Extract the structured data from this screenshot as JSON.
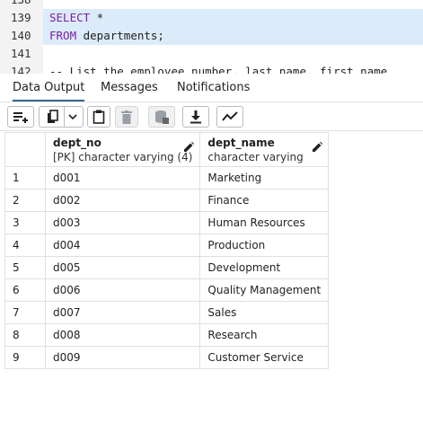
{
  "editor": {
    "lines": [
      {
        "num": "138",
        "code": ""
      },
      {
        "num": "139",
        "kw": "SELECT",
        "rest": " *"
      },
      {
        "num": "140",
        "kw": "FROM",
        "rest": " departments;"
      },
      {
        "num": "141",
        "code": ""
      },
      {
        "num": "142",
        "comment": "-- List the employee number, last name, first name"
      }
    ]
  },
  "tabs": [
    {
      "label": "Data Output",
      "active": true
    },
    {
      "label": "Messages",
      "active": false
    },
    {
      "label": "Notifications",
      "active": false
    }
  ],
  "toolbar": {
    "icons": [
      "add-row-icon",
      "copy-icon",
      "dropdown-chevron-icon",
      "paste-icon",
      "delete-icon",
      "save-data-icon",
      "download-icon",
      "graph-visualiser-icon"
    ]
  },
  "grid": {
    "columns": [
      {
        "name": "dept_no",
        "type": "[PK] character varying (4)"
      },
      {
        "name": "dept_name",
        "type": "character varying"
      }
    ],
    "rows": [
      {
        "n": "1",
        "dept_no": "d001",
        "dept_name": "Marketing"
      },
      {
        "n": "2",
        "dept_no": "d002",
        "dept_name": "Finance"
      },
      {
        "n": "3",
        "dept_no": "d003",
        "dept_name": "Human Resources"
      },
      {
        "n": "4",
        "dept_no": "d004",
        "dept_name": "Production"
      },
      {
        "n": "5",
        "dept_no": "d005",
        "dept_name": "Development"
      },
      {
        "n": "6",
        "dept_no": "d006",
        "dept_name": "Quality Management"
      },
      {
        "n": "7",
        "dept_no": "d007",
        "dept_name": "Sales"
      },
      {
        "n": "8",
        "dept_no": "d008",
        "dept_name": "Research"
      },
      {
        "n": "9",
        "dept_no": "d009",
        "dept_name": "Customer Service"
      }
    ]
  },
  "colors": {
    "highlight": "#dcebfa",
    "keyword": "#7a1fa2",
    "comment": "#b35a17",
    "tab_underline": "#326690"
  }
}
